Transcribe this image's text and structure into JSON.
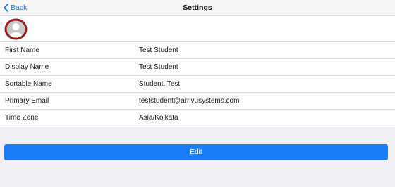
{
  "navbar": {
    "back_label": "Back",
    "title": "Settings"
  },
  "profile": {
    "avatar_icon": "user-avatar-icon"
  },
  "fields": [
    {
      "label": "First Name",
      "value": "Test Student"
    },
    {
      "label": "Display Name",
      "value": "Test Student"
    },
    {
      "label": "Sortable Name",
      "value": "Student, Test"
    },
    {
      "label": "Primary Email",
      "value": "teststudent@arrivusystems.com"
    },
    {
      "label": "Time Zone",
      "value": "Asia/Kolkata"
    }
  ],
  "actions": {
    "edit_label": "Edit"
  },
  "colors": {
    "accent": "#1a7cf7",
    "avatar_ring": "#a31a1a",
    "background": "#efeff4"
  }
}
